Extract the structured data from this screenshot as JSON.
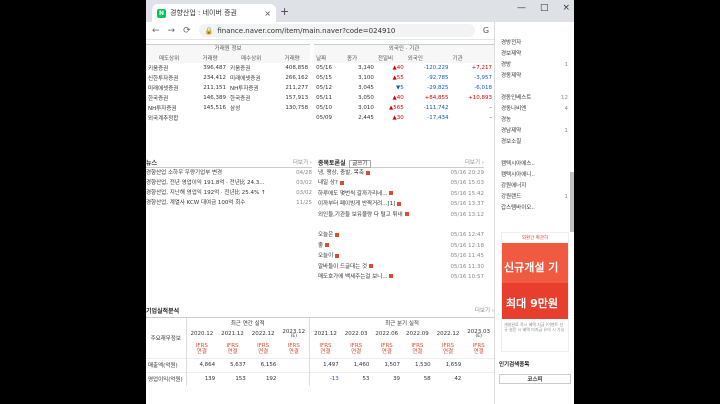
{
  "browser": {
    "tab_title": "경향산업 : 네이버 증권",
    "tab_close": "×",
    "new_tab": "+",
    "url": "finance.naver.com/item/main.naver?code=024910",
    "win_min": "—",
    "win_max": "□",
    "win_close": "×"
  },
  "trade": {
    "left_header": "거래원 정보",
    "col_sell_firm": "매도상위",
    "col_qty": "거래량",
    "col_buy_firm": "매수상위",
    "col_qty2": "거래량",
    "rows": [
      {
        "sell": "키움증권",
        "sq": "396,487",
        "buy": "키움증권",
        "bq": "408,858"
      },
      {
        "sell": "신한투자증권",
        "sq": "234,412",
        "buy": "미래에셋증권",
        "bq": "266,162"
      },
      {
        "sell": "미래에셋증권",
        "sq": "211,151",
        "buy": "NH투자증권",
        "bq": "211,277"
      },
      {
        "sell": "한국증권",
        "sq": "146,389",
        "buy": "한국증권",
        "bq": "157,913"
      },
      {
        "sell": "NH투자증권",
        "sq": "145,516",
        "buy": "삼성",
        "bq": "130,758"
      }
    ],
    "foreign_total": "외국계추정합",
    "right_header": "외국인 · 기관",
    "col_date": "날짜",
    "col_close": "종가",
    "col_change": "전일비",
    "col_foreign": "외국인",
    "col_inst": "기관",
    "frows": [
      {
        "d": "05/16",
        "c": "3,140",
        "ch": "▲40",
        "dir": "up",
        "f": "-120,229",
        "i": "+7,217"
      },
      {
        "d": "05/15",
        "c": "3,100",
        "ch": "▲55",
        "dir": "up",
        "f": "-92,785",
        "i": "-3,957"
      },
      {
        "d": "05/12",
        "c": "3,045",
        "ch": "▼5",
        "dir": "dn",
        "f": "-29,825",
        "i": "-6,018"
      },
      {
        "d": "05/11",
        "c": "3,050",
        "ch": "▲40",
        "dir": "up",
        "f": "+84,855",
        "i": "+10,893"
      },
      {
        "d": "05/10",
        "c": "3,010",
        "ch": "▲565",
        "dir": "up",
        "f": "-111,742",
        "i": "–"
      },
      {
        "d": "05/09",
        "c": "2,445",
        "ch": "▲30",
        "dir": "up",
        "f": "-17,434",
        "i": "–"
      }
    ]
  },
  "news": {
    "title": "뉴스",
    "more": "더보기 ›",
    "items": [
      {
        "t": "경향산업 소하우 우량기업부 변경",
        "d": "04/28"
      },
      {
        "t": "경향산업, 전년 영업이익 191.8억 · 전년比 24.3...",
        "d": "03/02"
      },
      {
        "t": "경향산업, 지난해 영업익 192억 · 전년比 25.4% ↑",
        "d": "03/02"
      },
      {
        "t": "경향산업, 계열사 KCW 대여금 100억 회수",
        "d": "11/25"
      }
    ]
  },
  "board": {
    "title": "종목토론실",
    "write": "글쓰기",
    "more": "더보기 ›",
    "items": [
      {
        "t": "냉, 땡상, 충발, 목축",
        "d": "05/16 20:29",
        "n": true
      },
      {
        "t": "내일 상?",
        "d": "05/16 15:03",
        "n": true
      },
      {
        "t": "하루에도 몇번씩 갈까가리네...",
        "d": "05/16 15:42",
        "n": true
      },
      {
        "t": "이까부터 페이빙게 반짝거려...[1]",
        "d": "05/16 13:37",
        "n": true
      },
      {
        "t": "외인들,기관들 보유물량 다 털고 튀네",
        "d": "05/16 13:12",
        "n": true
      },
      {
        "t": "",
        "d": "",
        "n": false
      },
      {
        "t": "오늘은",
        "d": "05/16 12:47",
        "n": true
      },
      {
        "t": "좋",
        "d": "05/16 12:18",
        "n": true
      },
      {
        "t": "오늘이",
        "d": "05/16 11:45",
        "n": true
      },
      {
        "t": "알바들이 드글대는 것",
        "d": "05/16 11:30",
        "n": true
      },
      {
        "t": "매도호가에 백세주는걸 보니...",
        "d": "05/16 10:57",
        "n": true
      }
    ]
  },
  "fin": {
    "title": "기업실적분석",
    "more": "더보기 ›",
    "annual_header": "최근 연간 실적",
    "quarter_header": "최근 분기 실적",
    "row_label_header": "주요재무정보",
    "periods_annual": [
      "2020.12",
      "2021.12",
      "2022.12",
      "2023.12"
    ],
    "periods_quarter": [
      "2021.12",
      "2022.03",
      "2022.06",
      "2022.09",
      "2022.12",
      "2023.03"
    ],
    "est_mark": "(E)",
    "ifrs": "IFRS",
    "ifrs_sub": "연결",
    "rows": [
      {
        "label": "매출액(억원)",
        "a": [
          "4,864",
          "5,637",
          "6,156",
          ""
        ],
        "q": [
          "1,497",
          "1,460",
          "1,507",
          "1,530",
          "1,659",
          ""
        ]
      },
      {
        "label": "영업이익(억원)",
        "a": [
          "139",
          "153",
          "192",
          ""
        ],
        "q": [
          "-13",
          "53",
          "39",
          "58",
          "42",
          ""
        ]
      }
    ]
  },
  "sidebar": {
    "items": [
      {
        "t": "경방전자",
        "v": ""
      },
      {
        "t": "경보제약",
        "v": ""
      },
      {
        "t": "경방",
        "v": "1"
      },
      {
        "t": "경동제약",
        "v": ""
      },
      {
        "t": "",
        "v": ""
      },
      {
        "t": "경동인베스트",
        "v": "12"
      },
      {
        "t": "경동나비엔",
        "v": "4"
      },
      {
        "t": "경농",
        "v": ""
      },
      {
        "t": "경남제약",
        "v": "1"
      },
      {
        "t": "경보소칠",
        "v": ""
      },
      {
        "t": "",
        "v": ""
      },
      {
        "t": "캠텍시아에스..",
        "v": ""
      },
      {
        "t": "캠텍시아에니..",
        "v": ""
      },
      {
        "t": "강원에너지",
        "v": ""
      },
      {
        "t": "강원랜드",
        "v": "1"
      },
      {
        "t": "갑스템바이오..",
        "v": ""
      }
    ],
    "banner_small": "외환간 확관하",
    "banner_line1": "신규개설 기",
    "banner_line2": "최대 9만원",
    "banner_note": "개설완료 즉시 혜택 지급 /이벤트 신규 설문 시 혜택 미지급 유의 시 가능",
    "popular_title": "인기검색종목",
    "popular_tab": "코스피"
  }
}
